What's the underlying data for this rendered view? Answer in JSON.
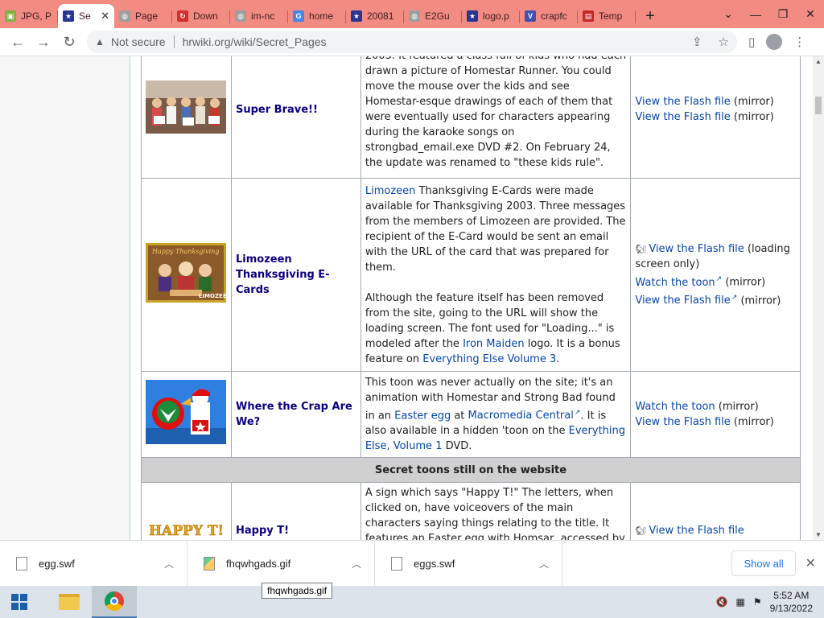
{
  "browser": {
    "tabs": [
      {
        "label": "JPG, P",
        "fav_color": "#7cb342",
        "fav_glyph": "▣",
        "active": false
      },
      {
        "label": "Se",
        "fav_color": "#283593",
        "fav_glyph": "★",
        "active": true
      },
      {
        "label": "Page",
        "fav_color": "#9e9e9e",
        "fav_glyph": "◍",
        "active": false
      },
      {
        "label": "Down",
        "fav_color": "#d32f2f",
        "fav_glyph": "↻",
        "active": false
      },
      {
        "label": "im-nc",
        "fav_color": "#9e9e9e",
        "fav_glyph": "◍",
        "active": false
      },
      {
        "label": "home",
        "fav_color": "#4285f4",
        "fav_glyph": "G",
        "active": false
      },
      {
        "label": "20081",
        "fav_color": "#283593",
        "fav_glyph": "★",
        "active": false
      },
      {
        "label": "E2Gu",
        "fav_color": "#9e9e9e",
        "fav_glyph": "◍",
        "active": false
      },
      {
        "label": "logo.p",
        "fav_color": "#283593",
        "fav_glyph": "★",
        "active": false
      },
      {
        "label": "crapfc",
        "fav_color": "#3f51b5",
        "fav_glyph": "V",
        "active": false
      },
      {
        "label": "Temp",
        "fav_color": "#c62828",
        "fav_glyph": "▤",
        "active": false
      }
    ],
    "new_tab": "+",
    "address": {
      "security_label": "Not secure",
      "url": "hrwiki.org/wiki/Secret_Pages"
    }
  },
  "table": {
    "rows": [
      {
        "title": "Super Brave!!",
        "desc_before": "2003. It featured a class full of kids who had each drawn a picture of Homestar Runner. You could move the mouse over the kids and see Homestar-esque drawings of each of them that were eventually used for characters appearing during the karaoke songs on strongbad_email.exe DVD #2. On February 24, the update was renamed to \"these kids rule\".",
        "links": [
          {
            "text": "View the Flash file",
            "suffix": " (mirror)"
          },
          {
            "text": "View the Flash file",
            "suffix": " (mirror)"
          }
        ]
      },
      {
        "title": "Limozeen Thanksgiving E-Cards",
        "p1_link": "Limozeen",
        "p1_text": " Thanksgiving E-Cards were made available for Thanksgiving 2003. Three messages from the members of Limozeen are provided. The recipient of the E-Card would be sent an email with the URL of the card that was prepared for them.",
        "p2_text": "Although the feature itself has been removed from the site, going to the URL will show the loading screen. The font used for \"Loading...\" is modeled after the ",
        "p2_link1": "Iron Maiden",
        "p2_mid": " logo. It is a bonus feature on ",
        "p2_link2": "Everything Else Volume 3",
        "p2_end": ".",
        "links": [
          {
            "text": "View the Flash file",
            "suffix": " (loading screen only)"
          },
          {
            "text": "Watch the toon",
            "suffix": " (mirror)"
          },
          {
            "text": "View the Flash file",
            "suffix": " (mirror)"
          }
        ]
      },
      {
        "title": "Where the Crap Are We?",
        "t1": "This toon was never actually on the site; it's an animation with Homestar and Strong Bad found in an ",
        "l1": "Easter egg",
        "t2": " at ",
        "l2": "Macromedia Central",
        "t3": ". It is also available in a hidden 'toon on the ",
        "l3": "Everything Else, Volume 1",
        "t4": " DVD.",
        "links": [
          {
            "text": "Watch the toon",
            "suffix": " (mirror)"
          },
          {
            "text": "View the Flash file",
            "suffix": " (mirror)"
          }
        ]
      }
    ],
    "section_header": "Secret toons still on the website",
    "last_row": {
      "title": "Happy T!",
      "img_text": "HAPPY T!",
      "desc": "A sign which says \"Happy T!\" The letters, when clicked on, have voiceovers of the main characters saying things relating to the title. It features an Easter egg with Homsar, accessed by clicking on a",
      "link": "View the Flash file"
    },
    "limozeen_img_text": "Happy Thanksgiving",
    "limozeen_img_logo": "LIMOZEEN"
  },
  "downloads": {
    "items": [
      {
        "name": "egg.swf",
        "type": "file"
      },
      {
        "name": "fhqwhgads.gif",
        "type": "image"
      },
      {
        "name": "eggs.swf",
        "type": "file"
      }
    ],
    "show_all": "Show all",
    "tooltip": "fhqwhgads.gif"
  },
  "taskbar": {
    "time": "5:52 AM",
    "date": "9/13/2022"
  },
  "colors": {
    "tabbar": "#f28b82",
    "link": "#0645ad",
    "title_link": "#0b0080"
  }
}
